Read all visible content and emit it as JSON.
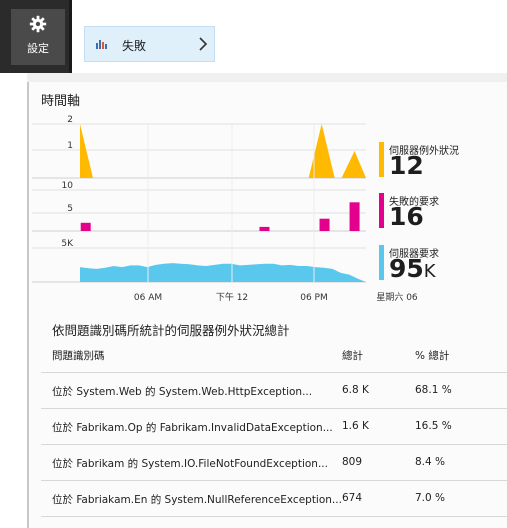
{
  "header": {
    "settings_label": "設定",
    "failures_label": "失敗"
  },
  "section_title": "時間軸",
  "chart_data": {
    "type": "area",
    "x_tick_labels": [
      "06 AM",
      "下午 12",
      "06 PM",
      "星期六 06"
    ],
    "panels": [
      {
        "series": "伺服器例外狀況",
        "color": "#ffb900",
        "y_ticks": [
          "2",
          "1"
        ],
        "ylim": [
          0,
          2
        ],
        "kind": "spike",
        "spikes": [
          {
            "x": 0.0,
            "value": 2
          },
          {
            "x": 0.845,
            "value": 2
          },
          {
            "x": 0.96,
            "value": 1
          }
        ]
      },
      {
        "series": "失敗的要求",
        "color": "#e3008c",
        "y_ticks": [
          "10",
          "5"
        ],
        "ylim": [
          0,
          10
        ],
        "kind": "bar",
        "bars": [
          {
            "x": 0.02,
            "value": 2
          },
          {
            "x": 0.645,
            "value": 1
          },
          {
            "x": 0.855,
            "value": 3
          },
          {
            "x": 0.96,
            "value": 7
          }
        ]
      },
      {
        "series": "伺服器要求",
        "color": "#5ac8ed",
        "y_ticks": [
          "5K"
        ],
        "ylim": [
          0,
          7000
        ],
        "kind": "area",
        "values": [
          2600,
          2400,
          2300,
          2500,
          2800,
          2600,
          2900,
          2900,
          2600,
          3000,
          3200,
          3300,
          3200,
          3100,
          2900,
          2800,
          3000,
          3200,
          3200,
          2900,
          3000,
          3100,
          3200,
          3200,
          2900,
          3000,
          2800,
          2800,
          2600,
          2500,
          2300,
          1600,
          1300,
          600,
          0
        ]
      }
    ]
  },
  "stats": [
    {
      "name": "伺服器例外狀況",
      "value": "12",
      "unit": "",
      "color": "#ffb900"
    },
    {
      "name": "失敗的要求",
      "value": "16",
      "unit": "",
      "color": "#e3008c"
    },
    {
      "name": "伺服器要求",
      "value": "95",
      "unit": "K",
      "color": "#5ac8ed"
    }
  ],
  "table": {
    "title": "依問題識別碼所統計的伺服器例外狀況總計",
    "headers": {
      "id": "問題識別碼",
      "total": "總計",
      "pct": "% 總計"
    },
    "rows": [
      {
        "id": "位於 System.Web 的 System.Web.HttpException...",
        "total": "6.8 K",
        "pct": "68.1 %"
      },
      {
        "id": "位於 Fabrikam.Op 的 Fabrikam.InvalidDataException...",
        "total": "1.6 K",
        "pct": "16.5 %"
      },
      {
        "id": "位於 Fabrikam 的 System.IO.FileNotFoundException...",
        "total": "809",
        "pct": "8.4 %"
      },
      {
        "id": "位於 Fabriakam.En 的 System.NullReferenceException...",
        "total": "674",
        "pct": "7.0 %"
      }
    ]
  }
}
